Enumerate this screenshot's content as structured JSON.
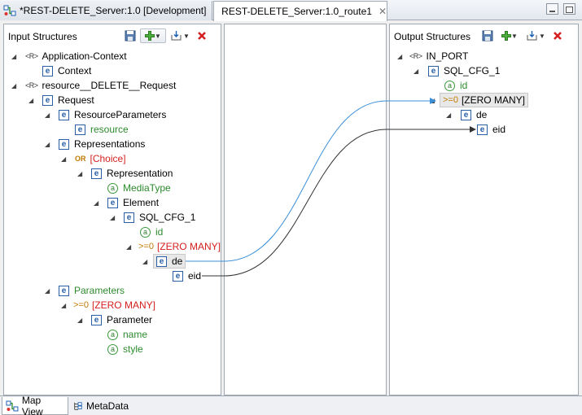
{
  "tabs": [
    {
      "label": "*REST-DELETE_Server:1.0 [Development]"
    },
    {
      "label": "REST-DELETE_Server:1.0_route1",
      "close": "✕"
    }
  ],
  "input": {
    "title": "Input Structures",
    "nodes": [
      {
        "label": "Application-Context",
        "icon": "<R>"
      },
      {
        "label": "Context",
        "icon": "e"
      },
      {
        "label": "resource__DELETE__Request",
        "icon": "<R>"
      },
      {
        "label": "Request",
        "icon": "e"
      },
      {
        "label": "ResourceParameters",
        "icon": "e"
      },
      {
        "label": "resource",
        "icon": "e"
      },
      {
        "label": "Representations",
        "icon": "e"
      },
      {
        "label": "[Choice]",
        "icon": "OR"
      },
      {
        "label": "Representation",
        "icon": "e"
      },
      {
        "label": "MediaType",
        "icon": "a"
      },
      {
        "label": "Element",
        "icon": "e"
      },
      {
        "label": "SQL_CFG_1",
        "icon": "e"
      },
      {
        "label": "id",
        "icon": "a"
      },
      {
        "label": "[ZERO MANY]",
        "icon": ">=0"
      },
      {
        "label": "de",
        "icon": "e"
      },
      {
        "label": "eid",
        "icon": "e"
      },
      {
        "label": "Parameters",
        "icon": "e"
      },
      {
        "label": "[ZERO MANY]",
        "icon": ">=0"
      },
      {
        "label": "Parameter",
        "icon": "e"
      },
      {
        "label": "name",
        "icon": "a"
      },
      {
        "label": "style",
        "icon": "a"
      }
    ]
  },
  "output": {
    "title": "Output Structures",
    "nodes": [
      {
        "label": "IN_PORT",
        "icon": "<R>"
      },
      {
        "label": "SQL_CFG_1",
        "icon": "e"
      },
      {
        "label": "id",
        "icon": "a"
      },
      {
        "label": "[ZERO MANY]",
        "icon": ">=0"
      },
      {
        "label": "de",
        "icon": "e"
      },
      {
        "label": "eid",
        "icon": "e"
      }
    ]
  },
  "bottom_tabs": [
    {
      "label": "Map View"
    },
    {
      "label": "MetaData"
    }
  ],
  "colors": {
    "link_selected": "#3b8fd9",
    "link_normal": "#333333",
    "attribute_text": "#2d8a2d",
    "choice_text": "#d42020"
  }
}
